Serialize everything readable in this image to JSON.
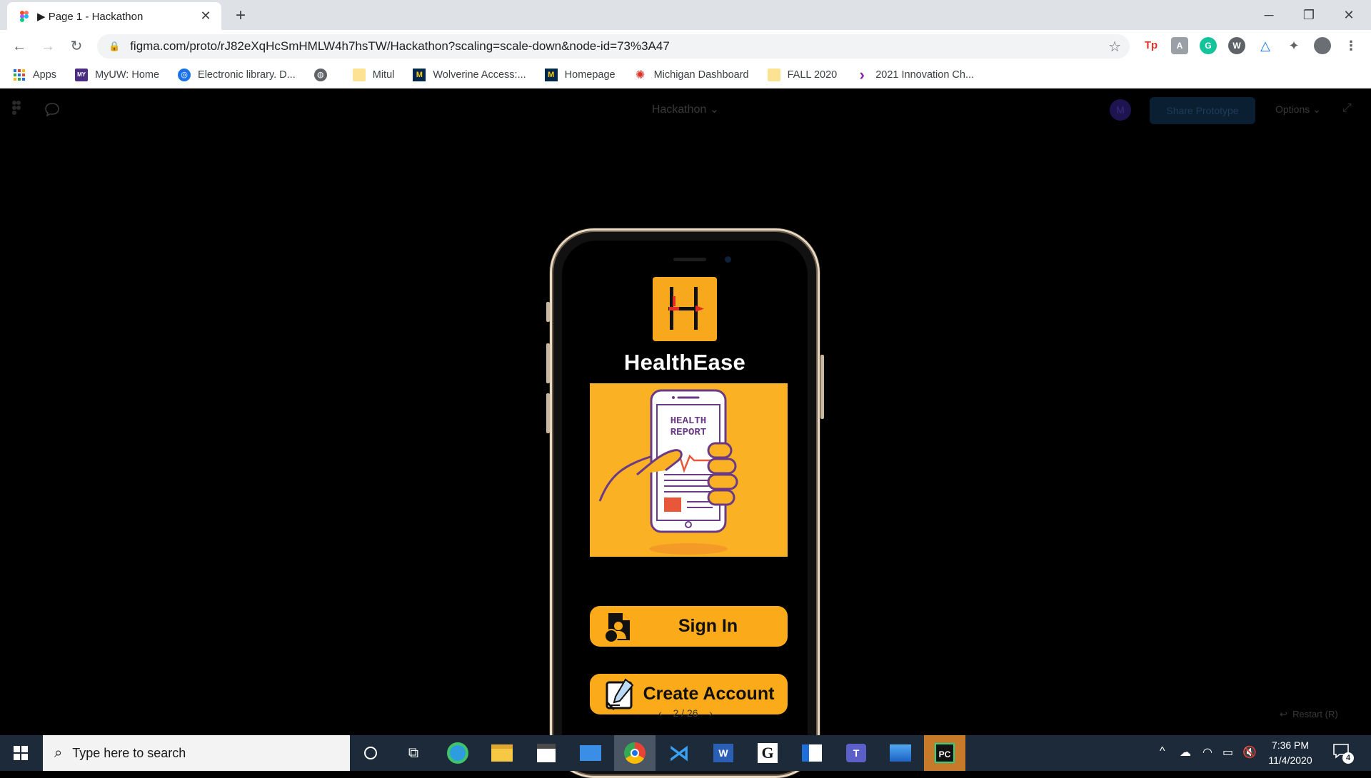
{
  "browser": {
    "tab_title": "▶ Page 1 - Hackathon",
    "url": "figma.com/proto/rJ82eXqHcSmHMLW4h7hsTW/Hackathon?scaling=scale-down&node-id=73%3A47",
    "bookmarks": [
      {
        "label": "Apps",
        "icon": "apps-grid-icon"
      },
      {
        "label": "MyUW: Home",
        "icon": "myuw-icon"
      },
      {
        "label": "Electronic library. D...",
        "icon": "globe-icon"
      },
      {
        "label": "",
        "icon": "globe-dark-icon"
      },
      {
        "label": "Mitul",
        "icon": "folder-icon"
      },
      {
        "label": "Wolverine Access:...",
        "icon": "michigan-m-icon"
      },
      {
        "label": "Homepage",
        "icon": "michigan-m-icon"
      },
      {
        "label": "Michigan Dashboard",
        "icon": "dashboard-icon"
      },
      {
        "label": "FALL 2020",
        "icon": "folder-icon"
      },
      {
        "label": "2021 Innovation Ch...",
        "icon": "chevron-purple-icon"
      }
    ]
  },
  "figma": {
    "file_title": "Hackathon",
    "share_label": "Share Prototype",
    "options_label": "Options",
    "avatar_initial": "M",
    "pager": "2 / 26",
    "restart_label": "Restart (R)"
  },
  "app": {
    "name": "HealthEase",
    "hero_text_line1": "HEALTH",
    "hero_text_line2": "REPORT",
    "sign_in_label": "Sign In",
    "create_account_label": "Create Account",
    "accent_color": "#fbaa19"
  },
  "taskbar": {
    "search_placeholder": "Type here to search",
    "time": "7:36 PM",
    "date": "11/4/2020",
    "notification_count": "4"
  }
}
